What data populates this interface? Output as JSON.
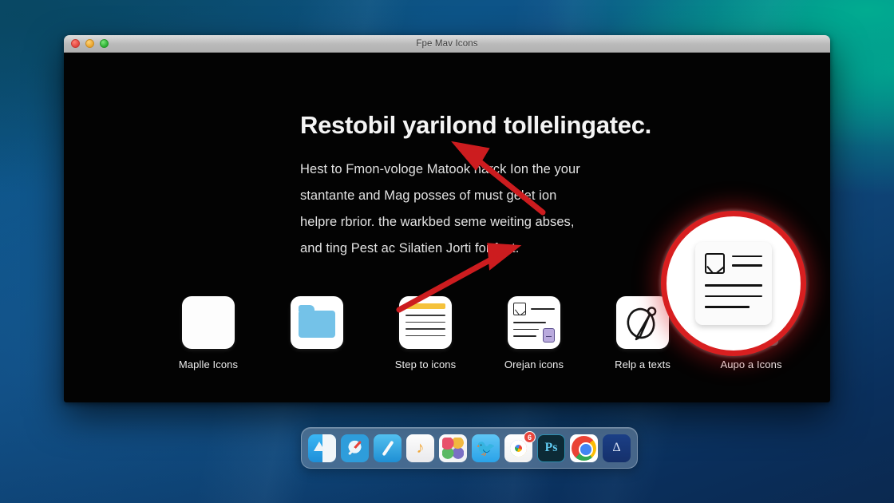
{
  "window": {
    "title": "Fpe Mav Icons",
    "traffic_lights": [
      {
        "name": "close",
        "color": "#e0443e"
      },
      {
        "name": "minimize",
        "color": "#e8a32b"
      },
      {
        "name": "maximize",
        "color": "#2aad32"
      }
    ]
  },
  "hero": {
    "headline": "Restobil yarilond tollelingatec.",
    "paragraph_lines": [
      "Hest to Fmon-vologe Matook harck Ion the your",
      "stantante and Mag posses of must gelet ion",
      "helpre rbrior. the warkbed seme weiting abses,",
      "and ting Pest ac Silatien Jorti for fest."
    ]
  },
  "icon_row": [
    {
      "label": "Maplle Icons",
      "icon": "blank-document-icon"
    },
    {
      "label": "",
      "icon": "folder-icon"
    },
    {
      "label": "Step to icons",
      "icon": "notes-icon"
    },
    {
      "label": "Orejan icons",
      "icon": "contact-card-icon"
    },
    {
      "label": "Relp a texts",
      "icon": "sketch-pen-icon"
    },
    {
      "label": "Aupo a Icons",
      "icon": "speech-bubble-icon"
    }
  ],
  "callout": {
    "name": "magnified-document-callout",
    "ring_color": "#d81f20",
    "icon": "document-preview-icon"
  },
  "annotations": {
    "arrow_color": "#cc1c1f",
    "arrows": [
      {
        "name": "arrow-to-text",
        "direction": "up-left"
      },
      {
        "name": "arrow-to-callout",
        "direction": "up-right"
      }
    ]
  },
  "dock": {
    "items": [
      {
        "label": "Finder",
        "icon": "finder-icon",
        "badge": ""
      },
      {
        "label": "Safari",
        "icon": "safari-icon",
        "badge": ""
      },
      {
        "label": "Compass",
        "icon": "compass-icon",
        "badge": ""
      },
      {
        "label": "iTunes",
        "icon": "music-note-icon",
        "badge": ""
      },
      {
        "label": "Photos",
        "icon": "photos-icon",
        "badge": ""
      },
      {
        "label": "Twitter",
        "icon": "twitter-icon",
        "badge": ""
      },
      {
        "label": "Google",
        "icon": "google-icon",
        "badge": "6"
      },
      {
        "label": "Ps",
        "icon": "photoshop-icon",
        "badge": ""
      },
      {
        "label": "Chrome",
        "icon": "chrome-icon",
        "badge": ""
      },
      {
        "label": "Sketch",
        "icon": "sketch-app-icon",
        "badge": ""
      }
    ]
  },
  "theme": {
    "window_body": "#030303",
    "titlebar": "#bcbcbc",
    "desktop_top_right": "#00a38e",
    "desktop_base": "#0d5488",
    "accent_red": "#d81f20",
    "folder_blue": "#74c2e8",
    "note_yellow": "#f5c23c",
    "bubble_gray": "#b4b4b4"
  },
  "dock_glyphs": {
    "music": "♪",
    "sketch": "Δ"
  }
}
